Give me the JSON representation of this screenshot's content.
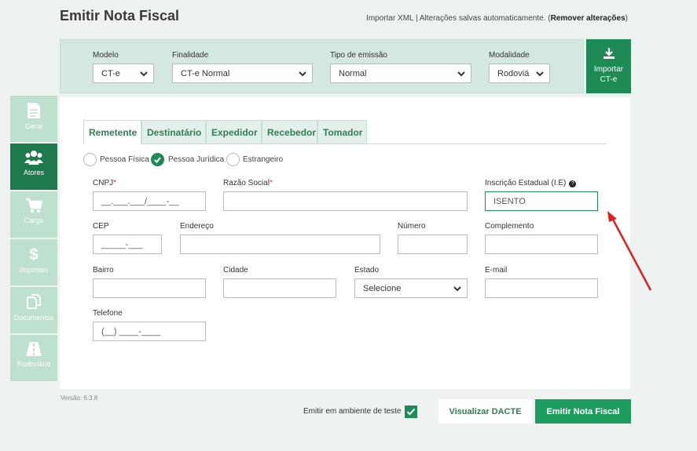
{
  "header": {
    "title": "Emitir Nota Fiscal",
    "info_prefix": "Importar XML | Alterações salvas automaticamente. (",
    "remove_link": "Remover alterações",
    "info_suffix": ")"
  },
  "topbar": {
    "modelo": {
      "label": "Modelo",
      "value": "CT-e"
    },
    "finalidade": {
      "label": "Finalidade",
      "value": "CT-e Normal"
    },
    "tipo_emissao": {
      "label": "Tipo de emissão",
      "value": "Normal"
    },
    "modalidade": {
      "label": "Modalidade",
      "value": "Rodoviá"
    },
    "import_button": {
      "line1": "Importar",
      "line2": "CT-e"
    }
  },
  "sidebar": {
    "items": [
      {
        "label": "Geral",
        "icon": "document-icon"
      },
      {
        "label": "Atores",
        "icon": "users-icon"
      },
      {
        "label": "Carga",
        "icon": "cart-icon"
      },
      {
        "label": "Impostos",
        "icon": "dollar-icon"
      },
      {
        "label": "Documentos",
        "icon": "documents-icon"
      },
      {
        "label": "Rodoviário",
        "icon": "road-icon"
      }
    ],
    "active": "Atores"
  },
  "tabs": [
    "Remetente",
    "Destinatário",
    "Expedidor",
    "Recebedor",
    "Tomador"
  ],
  "person_type": {
    "options": [
      "Pessoa Física",
      "Pessoa Jurídica",
      "Estrangeiro"
    ],
    "selected": "Pessoa Jurídica"
  },
  "form": {
    "cnpj": {
      "label": "CNPJ",
      "required": "*",
      "placeholder": "__.___.___/____-__"
    },
    "razao_social": {
      "label": "Razão Social",
      "required": "*",
      "value": ""
    },
    "ie": {
      "label": "Inscrição Estadual (I.E)",
      "help": "?",
      "value": "ISENTO"
    },
    "cep": {
      "label": "CEP",
      "placeholder": "_____-___"
    },
    "endereco": {
      "label": "Endereço",
      "value": ""
    },
    "numero": {
      "label": "Número",
      "value": ""
    },
    "complemento": {
      "label": "Complemento",
      "value": ""
    },
    "bairro": {
      "label": "Bairro",
      "value": ""
    },
    "cidade": {
      "label": "Cidade",
      "value": ""
    },
    "estado": {
      "label": "Estado",
      "value": "Selecione"
    },
    "email": {
      "label": "E-mail",
      "value": ""
    },
    "telefone": {
      "label": "Telefone",
      "placeholder": "(__) ____-____"
    }
  },
  "footer": {
    "version": "Versão: 6.3.8",
    "test_env_label": "Emitir em ambiente de teste",
    "test_env_checked": true,
    "preview_button": "Visualizar DACTE",
    "emit_button": "Emitir Nota Fiscal"
  },
  "colors": {
    "primary": "#1e8a55",
    "annotation_arrow": "#e02020"
  }
}
